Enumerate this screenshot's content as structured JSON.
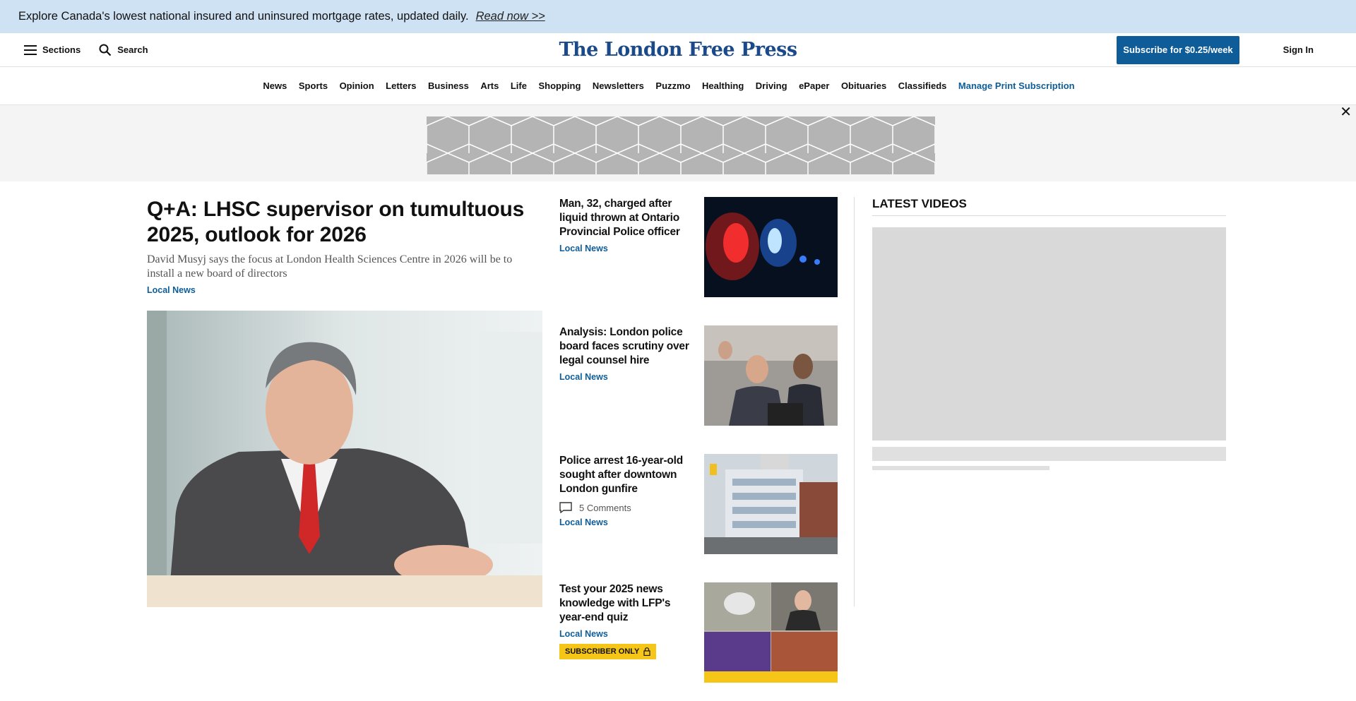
{
  "promo": {
    "text": "Explore Canada's lowest national insured and uninsured mortgage rates, updated daily.",
    "link": "Read now >>"
  },
  "header": {
    "sections_label": "Sections",
    "search_label": "Search",
    "logo": "The London Free Press",
    "subscribe_label": "Subscribe for $0.25/week",
    "signin_label": "Sign In"
  },
  "nav": {
    "items": [
      "News",
      "Sports",
      "Opinion",
      "Letters",
      "Business",
      "Arts",
      "Life",
      "Shopping",
      "Newsletters",
      "Puzzmo",
      "Healthing",
      "Driving",
      "ePaper",
      "Obituaries",
      "Classifieds"
    ],
    "manage_label": "Manage Print Subscription"
  },
  "lead": {
    "title": "Q+A: LHSC supervisor on tumultuous 2025, outlook for 2026",
    "deck": "David Musyj says the focus at London Health Sciences Centre in 2026 will be to install a new board of directors",
    "category": "Local News"
  },
  "stories": [
    {
      "title": "Man, 32, charged after liquid thrown at Ontario Provincial Police officer",
      "category": "Local News"
    },
    {
      "title": "Analysis: London police board faces scrutiny over legal counsel hire",
      "category": "Local News"
    },
    {
      "title": "Police arrest 16-year-old sought after downtown London gunfire",
      "comments": "5 Comments",
      "category": "Local News"
    },
    {
      "title": "Test your 2025 news knowledge with LFP's year-end quiz",
      "category": "Local News",
      "badge": "SUBSCRIBER ONLY"
    }
  ],
  "videos": {
    "title": "LATEST VIDEOS"
  },
  "colors": {
    "accent": "#0e5d99",
    "promo_bg": "#cfe2f3",
    "badge": "#f5c518"
  },
  "icons": [
    "menu-icon",
    "search-icon",
    "close-icon",
    "comment-icon",
    "lock-icon"
  ]
}
